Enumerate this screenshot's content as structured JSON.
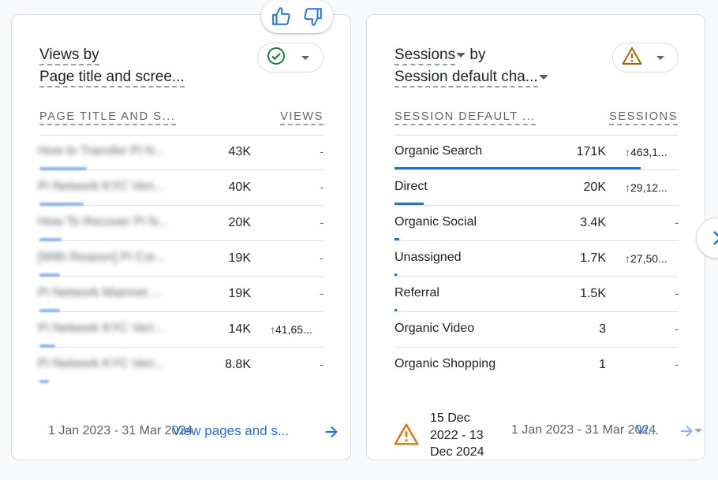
{
  "feedback": {
    "thumbs_up": "thumbs-up-icon",
    "thumbs_down": "thumbs-down-icon"
  },
  "card1": {
    "title_line1": "Views by",
    "title_line2": "Page title and scree...",
    "status_icon": "check-circle-icon",
    "col_dimension": "PAGE TITLE AND S...",
    "col_metric": "VIEWS",
    "rows": [
      {
        "label": "How to Transfer Pi N...",
        "value": "43K",
        "delta": "-",
        "bar_fraction": 1.0
      },
      {
        "label": "Pi Network KYC Veri...",
        "value": "40K",
        "delta": "-",
        "bar_fraction": 0.93
      },
      {
        "label": "How To Recover Pi N...",
        "value": "20K",
        "delta": "-",
        "bar_fraction": 0.47
      },
      {
        "label": "[With Reason] Pi Coi...",
        "value": "19K",
        "delta": "-",
        "bar_fraction": 0.44
      },
      {
        "label": "Pi Network Mainnet ...",
        "value": "19K",
        "delta": "-",
        "bar_fraction": 0.44
      },
      {
        "label": "Pi Network KYC Veri...",
        "value": "14K",
        "delta": "41,65...",
        "bar_fraction": 0.33
      },
      {
        "label": "Pi Network KYC Veri...",
        "value": "8.8K",
        "delta": "-",
        "bar_fraction": 0.2
      }
    ],
    "date_range": "1 Jan 2023 - 31 Mar 2024",
    "link": "View pages and s..."
  },
  "card2": {
    "title_word1": "Sessions",
    "title_word2": "by",
    "title_line2": "Session default cha...",
    "status_icon": "warning-icon",
    "col_dimension": "SESSION DEFAULT ...",
    "col_metric": "SESSIONS",
    "rows": [
      {
        "label": "Organic Search",
        "value": "171K",
        "delta": "463,1...",
        "up": true,
        "bar_fraction": 1.0
      },
      {
        "label": "Direct",
        "value": "20K",
        "delta": "29,12...",
        "up": true,
        "bar_fraction": 0.117
      },
      {
        "label": "Organic Social",
        "value": "3.4K",
        "delta": "-",
        "up": false,
        "bar_fraction": 0.02
      },
      {
        "label": "Unassigned",
        "value": "1.7K",
        "delta": "27,50...",
        "up": true,
        "bar_fraction": 0.01
      },
      {
        "label": "Referral",
        "value": "1.5K",
        "delta": "-",
        "up": false,
        "bar_fraction": 0.009
      },
      {
        "label": "Organic Video",
        "value": "3",
        "delta": "-",
        "up": false,
        "bar_fraction": 0
      },
      {
        "label": "Organic Shopping",
        "value": "1",
        "delta": "-",
        "up": false,
        "bar_fraction": 0
      }
    ],
    "warning_line1": "15 Dec",
    "warning_line2": "2022 - 13",
    "warning_line3": "Dec 2024",
    "date_range": "1 Jan 2023 - 31 Mar 2024",
    "link": "Vi..."
  },
  "colors": {
    "accent": "#1a73e8",
    "check": "#188038",
    "warning": "#b06000"
  }
}
